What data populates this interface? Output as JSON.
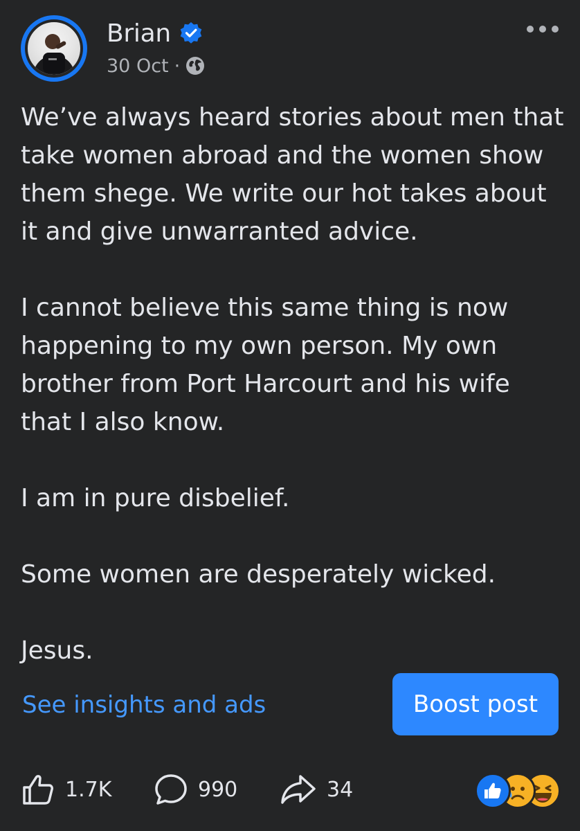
{
  "post": {
    "author": "Brian",
    "date": "30 Oct",
    "separator": "·",
    "audience_icon": "globe-icon",
    "verified_icon": "verified-badge-icon",
    "menu_icon": "more-options-icon",
    "paragraphs": [
      "We’ve always heard stories about men that take women abroad and the women show them shege. We write our hot takes about it and give unwarranted advice.",
      "I cannot believe this same thing is now happening to my own person. My own brother from Port Harcourt and his wife that I also know.",
      "I am in pure disbelief.",
      "Some women are desperately wicked.",
      "Jesus."
    ]
  },
  "footer": {
    "insights_label": "See insights and ads",
    "boost_label": "Boost post"
  },
  "actions": {
    "like_count": "1.7K",
    "comment_count": "990",
    "share_count": "34"
  },
  "reactions": [
    "like",
    "sad",
    "haha"
  ],
  "colors": {
    "background": "#242526",
    "text": "#e4e6eb",
    "muted": "#b0b3b8",
    "link": "#4599ff",
    "accent": "#2d88ff"
  }
}
